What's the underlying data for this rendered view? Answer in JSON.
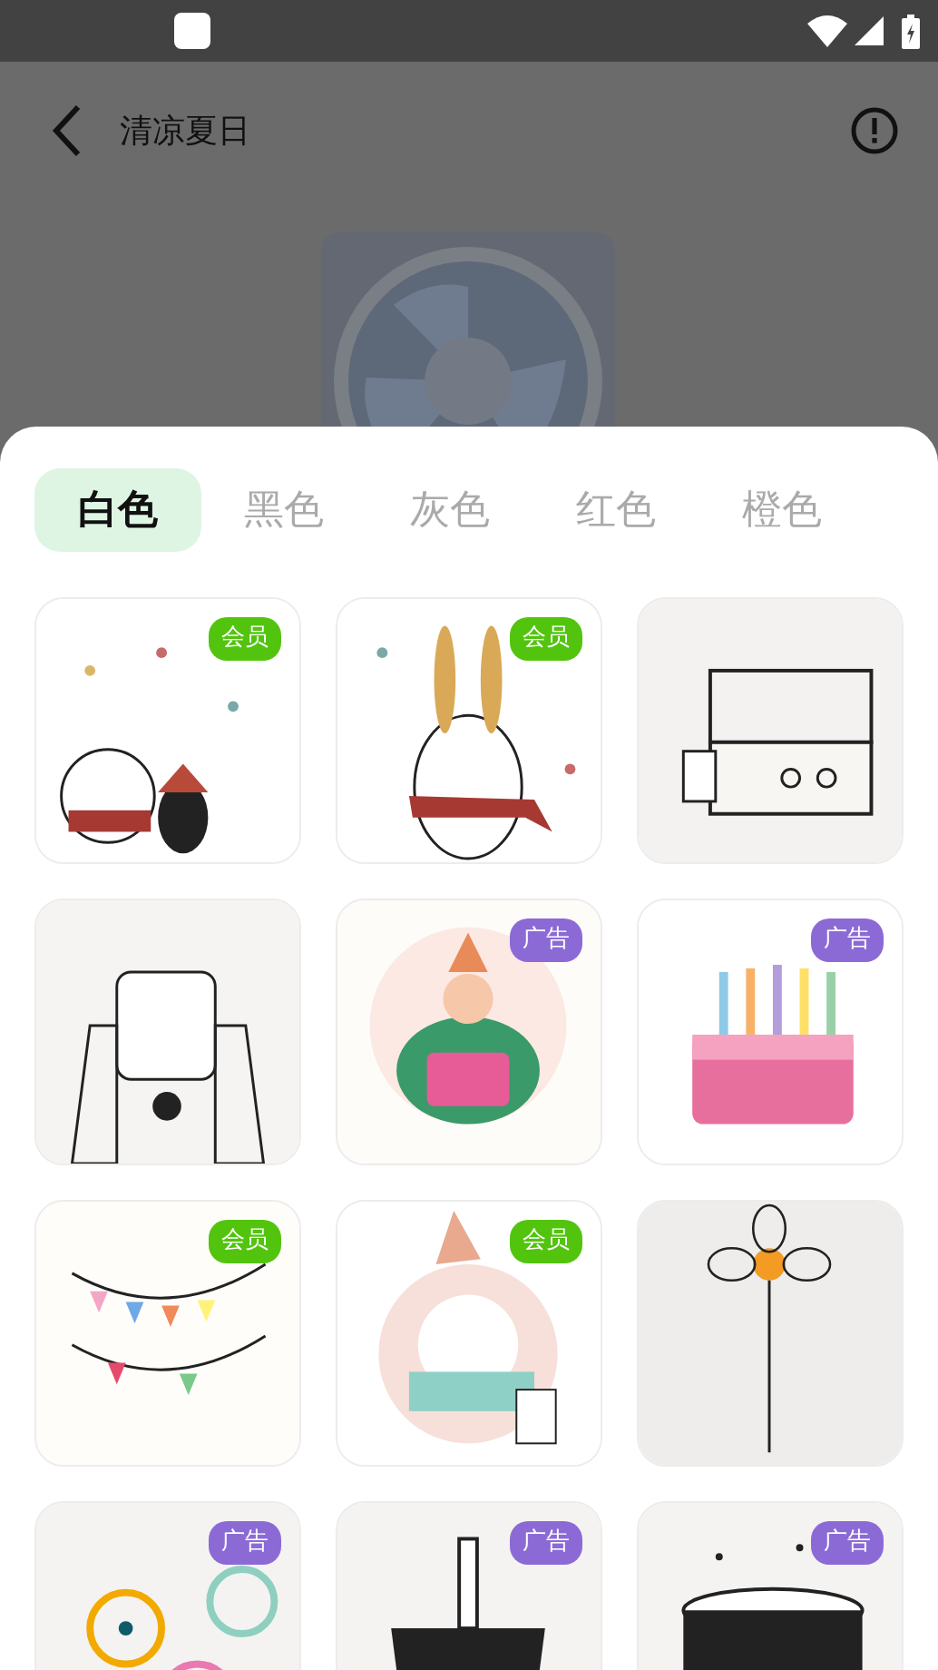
{
  "header": {
    "title": "清凉夏日"
  },
  "tabs": [
    {
      "label": "白色",
      "selected": true
    },
    {
      "label": "黑色",
      "selected": false
    },
    {
      "label": "灰色",
      "selected": false
    },
    {
      "label": "红色",
      "selected": false
    },
    {
      "label": "橙色",
      "selected": false
    }
  ],
  "stickers": [
    {
      "kind": "picture",
      "badge": {
        "kind": "vip",
        "text": "会员"
      }
    },
    {
      "kind": "picture",
      "badge": {
        "kind": "vip",
        "text": "会员"
      }
    },
    {
      "kind": "picture"
    },
    {
      "kind": "picture"
    },
    {
      "kind": "picture",
      "badge": {
        "kind": "ad",
        "text": "广告"
      }
    },
    {
      "kind": "picture",
      "badge": {
        "kind": "ad",
        "text": "广告"
      }
    },
    {
      "kind": "picture",
      "badge": {
        "kind": "vip",
        "text": "会员"
      }
    },
    {
      "kind": "picture",
      "badge": {
        "kind": "vip",
        "text": "会员"
      }
    },
    {
      "kind": "picture"
    },
    {
      "kind": "picture",
      "badge": {
        "kind": "ad",
        "text": "广告"
      }
    },
    {
      "kind": "picture",
      "badge": {
        "kind": "ad",
        "text": "广告"
      }
    },
    {
      "kind": "picture",
      "badge": {
        "kind": "ad",
        "text": "广告"
      }
    }
  ]
}
